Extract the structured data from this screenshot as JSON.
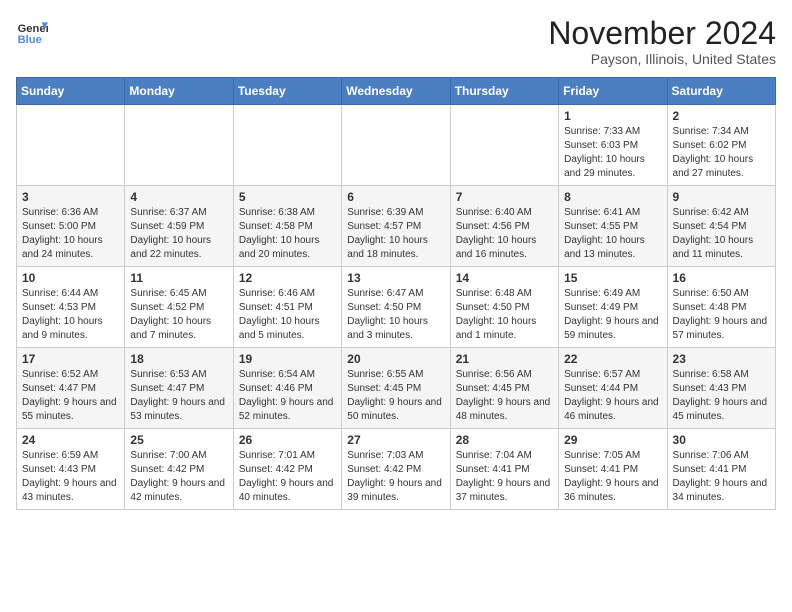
{
  "header": {
    "logo_line1": "General",
    "logo_line2": "Blue",
    "month_title": "November 2024",
    "location": "Payson, Illinois, United States"
  },
  "days_of_week": [
    "Sunday",
    "Monday",
    "Tuesday",
    "Wednesday",
    "Thursday",
    "Friday",
    "Saturday"
  ],
  "weeks": [
    [
      {
        "day": "",
        "info": ""
      },
      {
        "day": "",
        "info": ""
      },
      {
        "day": "",
        "info": ""
      },
      {
        "day": "",
        "info": ""
      },
      {
        "day": "",
        "info": ""
      },
      {
        "day": "1",
        "info": "Sunrise: 7:33 AM\nSunset: 6:03 PM\nDaylight: 10 hours and 29 minutes."
      },
      {
        "day": "2",
        "info": "Sunrise: 7:34 AM\nSunset: 6:02 PM\nDaylight: 10 hours and 27 minutes."
      }
    ],
    [
      {
        "day": "3",
        "info": "Sunrise: 6:36 AM\nSunset: 5:00 PM\nDaylight: 10 hours and 24 minutes."
      },
      {
        "day": "4",
        "info": "Sunrise: 6:37 AM\nSunset: 4:59 PM\nDaylight: 10 hours and 22 minutes."
      },
      {
        "day": "5",
        "info": "Sunrise: 6:38 AM\nSunset: 4:58 PM\nDaylight: 10 hours and 20 minutes."
      },
      {
        "day": "6",
        "info": "Sunrise: 6:39 AM\nSunset: 4:57 PM\nDaylight: 10 hours and 18 minutes."
      },
      {
        "day": "7",
        "info": "Sunrise: 6:40 AM\nSunset: 4:56 PM\nDaylight: 10 hours and 16 minutes."
      },
      {
        "day": "8",
        "info": "Sunrise: 6:41 AM\nSunset: 4:55 PM\nDaylight: 10 hours and 13 minutes."
      },
      {
        "day": "9",
        "info": "Sunrise: 6:42 AM\nSunset: 4:54 PM\nDaylight: 10 hours and 11 minutes."
      }
    ],
    [
      {
        "day": "10",
        "info": "Sunrise: 6:44 AM\nSunset: 4:53 PM\nDaylight: 10 hours and 9 minutes."
      },
      {
        "day": "11",
        "info": "Sunrise: 6:45 AM\nSunset: 4:52 PM\nDaylight: 10 hours and 7 minutes."
      },
      {
        "day": "12",
        "info": "Sunrise: 6:46 AM\nSunset: 4:51 PM\nDaylight: 10 hours and 5 minutes."
      },
      {
        "day": "13",
        "info": "Sunrise: 6:47 AM\nSunset: 4:50 PM\nDaylight: 10 hours and 3 minutes."
      },
      {
        "day": "14",
        "info": "Sunrise: 6:48 AM\nSunset: 4:50 PM\nDaylight: 10 hours and 1 minute."
      },
      {
        "day": "15",
        "info": "Sunrise: 6:49 AM\nSunset: 4:49 PM\nDaylight: 9 hours and 59 minutes."
      },
      {
        "day": "16",
        "info": "Sunrise: 6:50 AM\nSunset: 4:48 PM\nDaylight: 9 hours and 57 minutes."
      }
    ],
    [
      {
        "day": "17",
        "info": "Sunrise: 6:52 AM\nSunset: 4:47 PM\nDaylight: 9 hours and 55 minutes."
      },
      {
        "day": "18",
        "info": "Sunrise: 6:53 AM\nSunset: 4:47 PM\nDaylight: 9 hours and 53 minutes."
      },
      {
        "day": "19",
        "info": "Sunrise: 6:54 AM\nSunset: 4:46 PM\nDaylight: 9 hours and 52 minutes."
      },
      {
        "day": "20",
        "info": "Sunrise: 6:55 AM\nSunset: 4:45 PM\nDaylight: 9 hours and 50 minutes."
      },
      {
        "day": "21",
        "info": "Sunrise: 6:56 AM\nSunset: 4:45 PM\nDaylight: 9 hours and 48 minutes."
      },
      {
        "day": "22",
        "info": "Sunrise: 6:57 AM\nSunset: 4:44 PM\nDaylight: 9 hours and 46 minutes."
      },
      {
        "day": "23",
        "info": "Sunrise: 6:58 AM\nSunset: 4:43 PM\nDaylight: 9 hours and 45 minutes."
      }
    ],
    [
      {
        "day": "24",
        "info": "Sunrise: 6:59 AM\nSunset: 4:43 PM\nDaylight: 9 hours and 43 minutes."
      },
      {
        "day": "25",
        "info": "Sunrise: 7:00 AM\nSunset: 4:42 PM\nDaylight: 9 hours and 42 minutes."
      },
      {
        "day": "26",
        "info": "Sunrise: 7:01 AM\nSunset: 4:42 PM\nDaylight: 9 hours and 40 minutes."
      },
      {
        "day": "27",
        "info": "Sunrise: 7:03 AM\nSunset: 4:42 PM\nDaylight: 9 hours and 39 minutes."
      },
      {
        "day": "28",
        "info": "Sunrise: 7:04 AM\nSunset: 4:41 PM\nDaylight: 9 hours and 37 minutes."
      },
      {
        "day": "29",
        "info": "Sunrise: 7:05 AM\nSunset: 4:41 PM\nDaylight: 9 hours and 36 minutes."
      },
      {
        "day": "30",
        "info": "Sunrise: 7:06 AM\nSunset: 4:41 PM\nDaylight: 9 hours and 34 minutes."
      }
    ]
  ]
}
